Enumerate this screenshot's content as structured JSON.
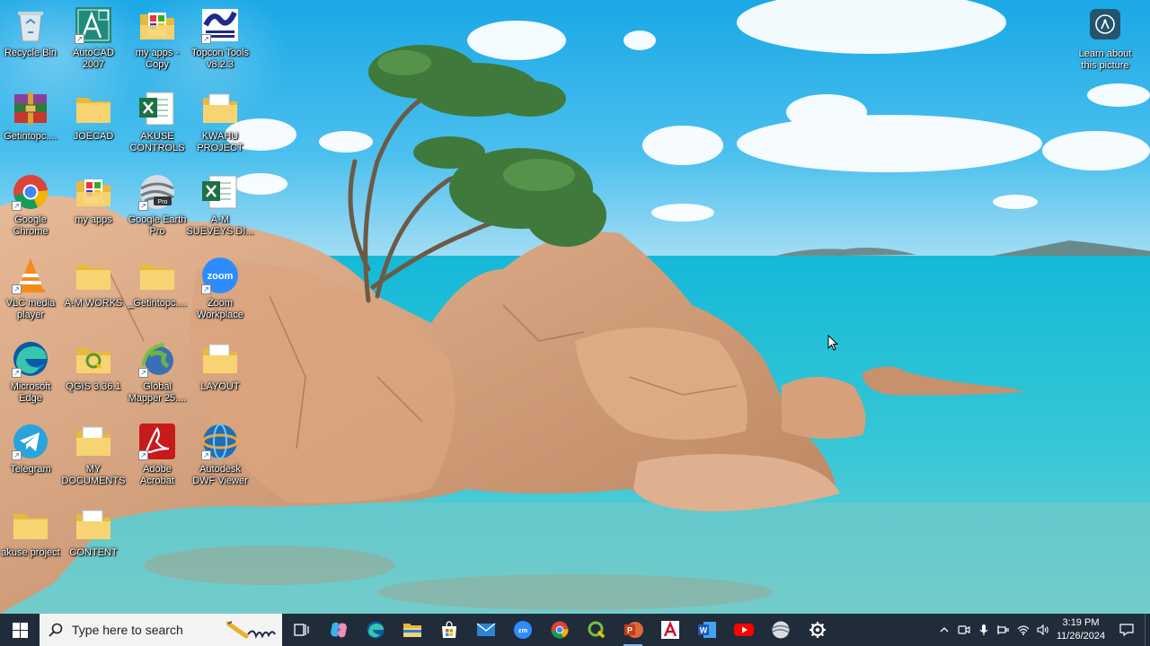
{
  "desktop": {
    "icons": [
      {
        "name": "recycle-bin-icon",
        "label": "Recycle Bin",
        "kind": "recycle",
        "shortcut": false
      },
      {
        "name": "autocad-icon",
        "label": "AutoCAD\n2007",
        "kind": "autocad",
        "shortcut": true
      },
      {
        "name": "my-apps-copy-icon",
        "label": "my apps -\nCopy",
        "kind": "folder-color",
        "shortcut": false
      },
      {
        "name": "topcon-tools-icon",
        "label": "Topcon Tools\nv8.2.3",
        "kind": "topcon",
        "shortcut": true
      },
      {
        "name": "getintopc-archive-icon",
        "label": "Getintopc....",
        "kind": "winrar",
        "shortcut": false
      },
      {
        "name": "joecad-folder-icon",
        "label": "JOECAD",
        "kind": "folder",
        "shortcut": false
      },
      {
        "name": "akuse-controls-icon",
        "label": "AKUSE\nCONTROLS",
        "kind": "excel",
        "shortcut": false
      },
      {
        "name": "kwahu-project-folder-icon",
        "label": "KWAHU\nPROJECT",
        "kind": "folder-doc",
        "shortcut": false
      },
      {
        "name": "google-chrome-icon",
        "label": "Google\nChrome",
        "kind": "chrome",
        "shortcut": true
      },
      {
        "name": "my-apps-folder-icon",
        "label": "my apps",
        "kind": "folder-color",
        "shortcut": false
      },
      {
        "name": "google-earth-pro-icon",
        "label": "Google Earth\nPro",
        "kind": "earth",
        "shortcut": true
      },
      {
        "name": "a-m-surveys-icon",
        "label": "A-M\nSUEVEYS DI...",
        "kind": "excel",
        "shortcut": false
      },
      {
        "name": "vlc-media-player-icon",
        "label": "VLC media\nplayer",
        "kind": "vlc",
        "shortcut": true
      },
      {
        "name": "a-m-works-folder-icon",
        "label": "A-M WORKS",
        "kind": "folder",
        "shortcut": false
      },
      {
        "name": "getintopc-folder-icon",
        "label": "_Getintopc....",
        "kind": "folder",
        "shortcut": false
      },
      {
        "name": "zoom-workplace-icon",
        "label": "Zoom\nWorkplace",
        "kind": "zoom",
        "shortcut": true
      },
      {
        "name": "microsoft-edge-icon",
        "label": "Microsoft\nEdge",
        "kind": "edge",
        "shortcut": true
      },
      {
        "name": "qgis-icon",
        "label": "QGIS 3.36.1",
        "kind": "qgis-folder",
        "shortcut": false
      },
      {
        "name": "global-mapper-icon",
        "label": "Global\nMapper 25....",
        "kind": "globalmapper",
        "shortcut": true
      },
      {
        "name": "layout-folder-icon",
        "label": "LAYOUT",
        "kind": "folder-doc",
        "shortcut": false
      },
      {
        "name": "telegram-icon",
        "label": "Telegram",
        "kind": "telegram",
        "shortcut": true
      },
      {
        "name": "my-documents-folder-icon",
        "label": "MY\nDOCUMENTS",
        "kind": "folder-doc",
        "shortcut": false
      },
      {
        "name": "adobe-acrobat-icon",
        "label": "Adobe\nAcrobat",
        "kind": "acrobat",
        "shortcut": true
      },
      {
        "name": "autodesk-dwf-viewer-icon",
        "label": "Autodesk\nDWF Viewer",
        "kind": "dwf",
        "shortcut": true
      },
      {
        "name": "akuse-project-folder-icon",
        "label": "akuse project",
        "kind": "folder",
        "shortcut": false
      },
      {
        "name": "content-folder-icon",
        "label": "CONTENT",
        "kind": "folder-doc",
        "shortcut": false
      }
    ],
    "learn_label": "Learn about\nthis picture"
  },
  "taskbar": {
    "search_placeholder": "Type here to search",
    "apps": [
      {
        "name": "task-view-icon",
        "kind": "taskview"
      },
      {
        "name": "copilot-icon",
        "kind": "copilot"
      },
      {
        "name": "edge-taskbar-icon",
        "kind": "edge"
      },
      {
        "name": "file-explorer-icon",
        "kind": "explorer"
      },
      {
        "name": "microsoft-store-icon",
        "kind": "store"
      },
      {
        "name": "mail-icon",
        "kind": "mail"
      },
      {
        "name": "zoom-taskbar-icon",
        "kind": "zoomtb"
      },
      {
        "name": "chrome-taskbar-icon",
        "kind": "chrome"
      },
      {
        "name": "qgis-taskbar-icon",
        "kind": "qgis"
      },
      {
        "name": "powerpoint-icon",
        "kind": "ppt",
        "active": true
      },
      {
        "name": "autocad-taskbar-icon",
        "kind": "acad"
      },
      {
        "name": "word-icon",
        "kind": "word"
      },
      {
        "name": "youtube-icon",
        "kind": "youtube"
      },
      {
        "name": "google-earth-taskbar-icon",
        "kind": "earth"
      },
      {
        "name": "settings-gear-icon",
        "kind": "gear"
      }
    ],
    "time": "3:19 PM",
    "date": "11/26/2024"
  }
}
